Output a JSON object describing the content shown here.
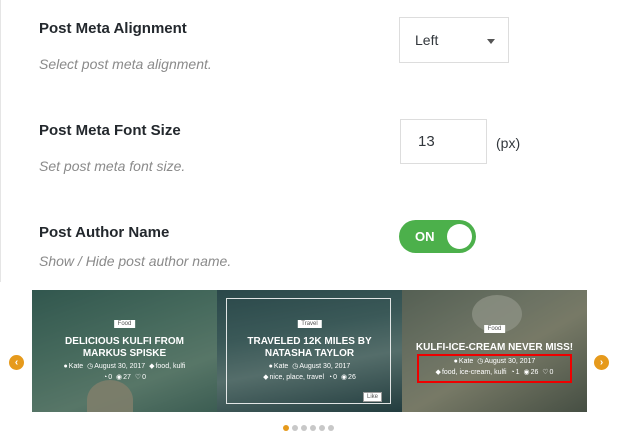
{
  "settings": {
    "meta_alignment": {
      "title": "Post Meta Alignment",
      "description": "Select post meta alignment.",
      "value": "Left"
    },
    "meta_font_size": {
      "title": "Post Meta Font Size",
      "description": "Set post meta font size.",
      "value": "13",
      "unit": "(px)"
    },
    "author_name": {
      "title": "Post Author Name",
      "description": "Show / Hide post author name.",
      "toggle_label": "ON",
      "enabled": true
    }
  },
  "slider": {
    "slides": [
      {
        "category": "Food",
        "title": "DELICIOUS KULFI FROM MARKUS SPISKE",
        "author": "Kate",
        "date": "August 30, 2017",
        "tags": "food, kulfi",
        "comments": "0",
        "views": "27",
        "likes": "0"
      },
      {
        "category": "Travel",
        "title": "TRAVELED 12K MILES BY NATASHA TAYLOR",
        "author": "Kate",
        "date": "August 30, 2017",
        "tags": "nice, place, travel",
        "comments": "0",
        "views": "26",
        "likes": "",
        "like_label": "Like"
      },
      {
        "category": "Food",
        "title": "KULFI-ICE-CREAM NEVER MISS!",
        "author": "Kate",
        "date": "August 30, 2017",
        "tags": "food, ice-cream, kulfi",
        "comments": "1",
        "views": "26",
        "likes": "0"
      }
    ],
    "prev_icon": "chevron-left-icon",
    "next_icon": "chevron-right-icon",
    "dots_count": 6,
    "active_dot": 0
  },
  "colors": {
    "toggle_on": "#4cb04b",
    "accent": "#e69a1c",
    "highlight": "#ee0000"
  }
}
